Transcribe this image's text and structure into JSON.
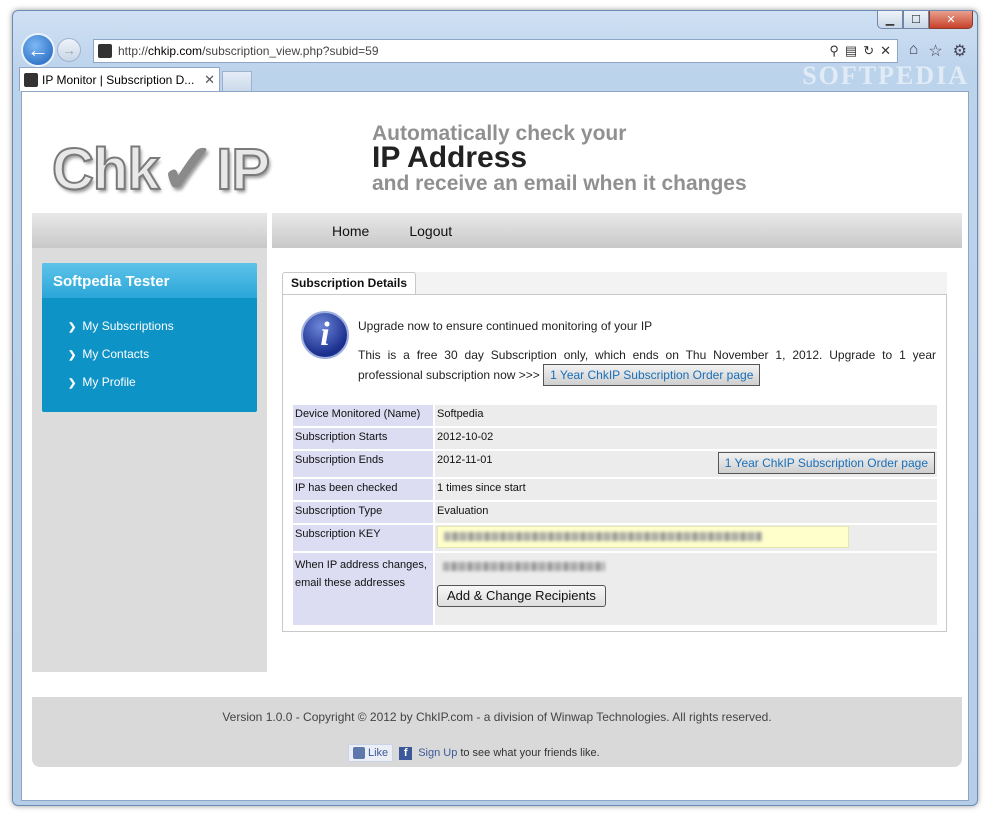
{
  "browser": {
    "url_prefix": "http://",
    "url_host": "chkip.com",
    "url_path": "/subscription_view.php?subid=59",
    "tab_title": "IP Monitor | Subscription D...",
    "tab_close": "✕",
    "watermark": "SOFTPEDIA",
    "window_buttons": {
      "minimize": "▁",
      "maximize": "☐",
      "close": "✕"
    }
  },
  "header": {
    "logo_left": "Chk",
    "logo_check": "✓",
    "logo_right": "IP",
    "tagline_top": "Automatically check your",
    "tagline_main": "IP Address",
    "tagline_bottom": "and receive an email when it changes"
  },
  "nav": {
    "home": "Home",
    "logout": "Logout"
  },
  "sidebar": {
    "user": "Softpedia Tester",
    "items": [
      {
        "label": "My Subscriptions"
      },
      {
        "label": "My Contacts"
      },
      {
        "label": "My Profile"
      }
    ]
  },
  "panel": {
    "tab": "Subscription Details",
    "upgrade_line1": "Upgrade now to ensure continued monitoring of your IP",
    "upgrade_line2": "This is a free 30 day Subscription only, which ends on Thu November 1, 2012. Upgrade to 1 year professional subscription now >>>",
    "order_button": "1 Year ChkIP Subscription Order page",
    "rows": {
      "device_label": "Device Monitored (Name)",
      "device_value": "Softpedia",
      "starts_label": "Subscription Starts",
      "starts_value": "2012-10-02",
      "ends_label": "Subscription Ends",
      "ends_value": "2012-11-01",
      "checked_label": "IP has been checked",
      "checked_value": "1 times since start",
      "type_label": "Subscription Type",
      "type_value": "Evaluation",
      "key_label": "Subscription KEY",
      "email_label_1": "When IP address changes,",
      "email_label_2": "email these addresses"
    },
    "recipients_button": "Add & Change Recipients"
  },
  "footer": {
    "copyright": "Version 1.0.0 - Copyright © 2012 by ChkIP.com - a division of Winwap Technologies. All rights reserved.",
    "like": "Like",
    "signup": "Sign Up",
    "friends": "to see what your friends like."
  }
}
